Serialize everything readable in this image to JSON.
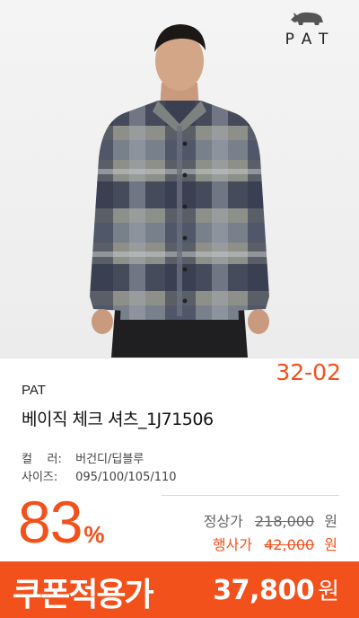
{
  "product": {
    "brand_logo": "PAT",
    "brand": "PAT",
    "style_code": "32-02",
    "name": "베이직 체크 셔츠_1J71506",
    "options": [
      {
        "key": "컬    러:",
        "value": "버건디/딥블루"
      },
      {
        "key": "사이즈:",
        "value": "095/100/105/110"
      }
    ]
  },
  "pricing": {
    "discount_number": "83",
    "discount_symbol": "%",
    "regular_label": "정상가",
    "regular_price": "218,000",
    "regular_unit": "원",
    "sale_label": "행사가",
    "sale_price": "42,000",
    "sale_unit": "원",
    "coupon_label": "쿠폰적용가",
    "coupon_price": "37,800",
    "coupon_unit": "원"
  },
  "colors": {
    "accent": "#f2511b",
    "text_dark": "#111111",
    "text_muted": "#666666"
  },
  "icons": [
    "rhino-logo-icon"
  ]
}
